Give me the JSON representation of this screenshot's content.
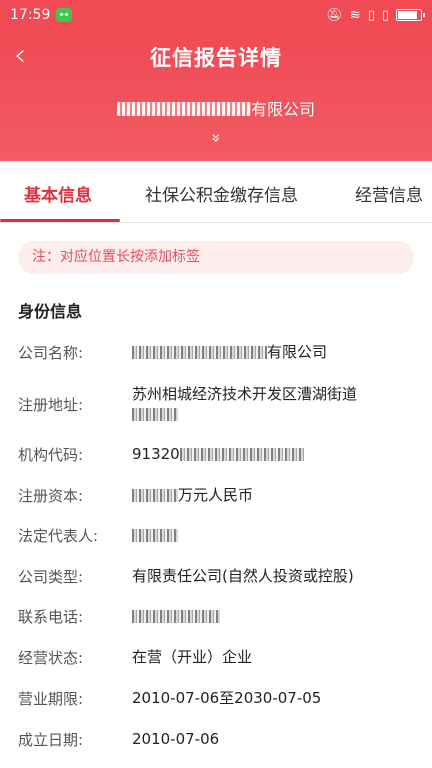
{
  "status": {
    "time": "17:59"
  },
  "header": {
    "title": "征信报告详情",
    "company_suffix": "有限公司",
    "expand_glyph": "»"
  },
  "tabs": [
    {
      "label": "基本信息",
      "active": true
    },
    {
      "label": "社保公积金缴存信息",
      "active": false
    },
    {
      "label": "经营信息",
      "active": false
    }
  ],
  "notice": "注：对应位置长按添加标签",
  "section_title": "身份信息",
  "fields": {
    "company_name": {
      "label": "公司名称:",
      "value_suffix": "有限公司"
    },
    "address": {
      "label": "注册地址:",
      "value": "苏州相城经济技术开发区漕湖街道"
    },
    "org_code": {
      "label": "机构代码:",
      "value_prefix": "91320"
    },
    "capital": {
      "label": "注册资本:",
      "value_suffix": "万元人民币"
    },
    "legal_rep": {
      "label": "法定代表人:"
    },
    "company_type": {
      "label": "公司类型:",
      "value": "有限责任公司(自然人投资或控股)"
    },
    "phone": {
      "label": "联系电话:"
    },
    "status": {
      "label": "经营状态:",
      "value": "在营（开业）企业"
    },
    "period": {
      "label": "营业期限:",
      "value": "2010-07-06至2030-07-05"
    },
    "founded": {
      "label": "成立日期:",
      "value": "2010-07-06"
    }
  },
  "colors": {
    "brand_red": "#f04a55",
    "active_tab": "#d9333f"
  }
}
